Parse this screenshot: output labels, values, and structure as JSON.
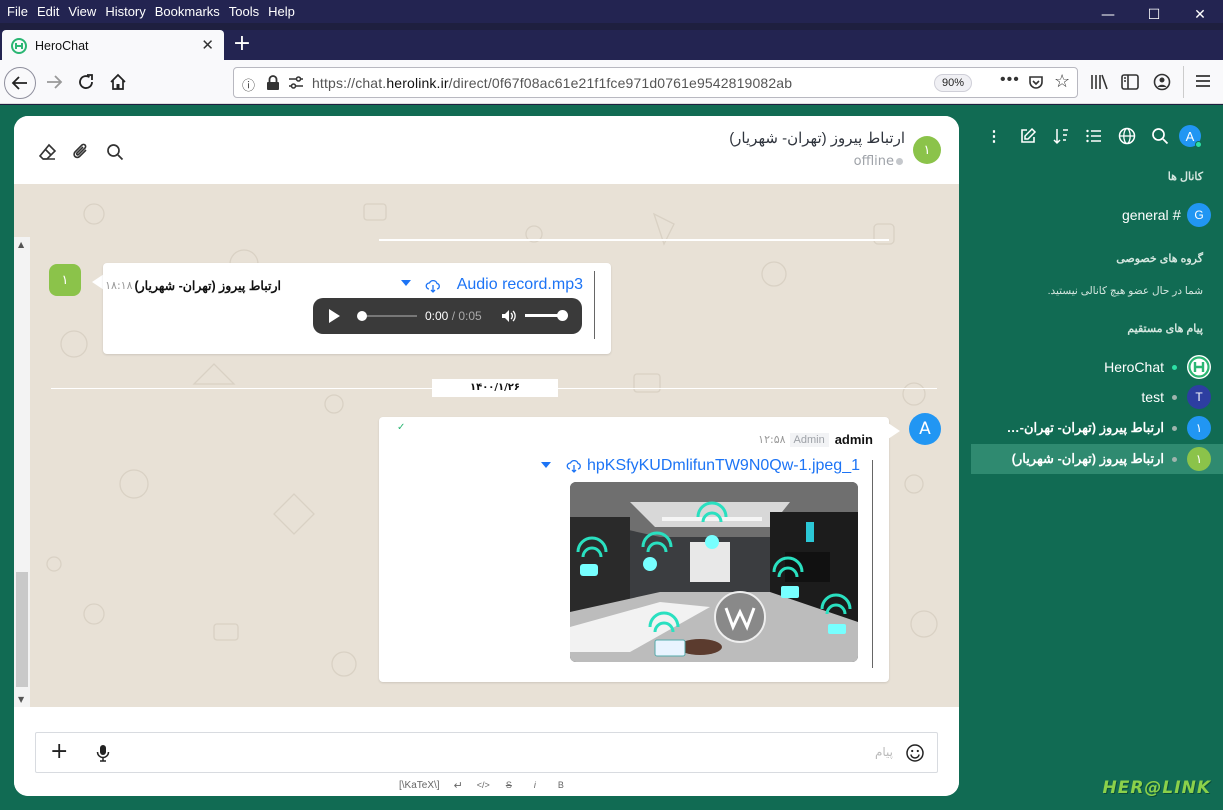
{
  "browser": {
    "menu": [
      "File",
      "Edit",
      "View",
      "History",
      "Bookmarks",
      "Tools",
      "Help"
    ],
    "tab_title": "HeroChat",
    "url_prefix": "https://chat.",
    "url_domain": "herolink.ir",
    "url_path": "/direct/0f67f08ac61e21f1fce971d0761e9542819082ab",
    "zoom": "90%",
    "win_min": "—",
    "win_max": "☐",
    "win_close": "✕"
  },
  "chat": {
    "contact_name": "ارتباط پیروز (تهران- شهریار)",
    "contact_status": "offline",
    "contact_avatar_letter": "۱",
    "messages": [
      {
        "author": "ارتباط پیروز (تهران- شهریار)",
        "time": "۱۸:۱۸",
        "avatar_letter": "۱",
        "file_name": "Audio record.mp3",
        "audio_current": "0:00",
        "audio_sep": " / ",
        "audio_total": "0:05",
        "progress": 0
      },
      {
        "date_divider": "۱۴۰۰/۱/۲۶"
      },
      {
        "author": "admin",
        "role": "Admin",
        "time": "۱۲:۵۸",
        "avatar_letter": "A",
        "file_name": "hpKSfyKUDmlifunTW9N0Qw-1.jpeg_1",
        "check": "✓"
      }
    ],
    "composer_placeholder": "پیام",
    "format_toolbar": [
      "B",
      "i",
      "S",
      "</>",
      "↵",
      "[\\KaTeX\\]"
    ]
  },
  "sidebar": {
    "user_avatar": "A",
    "channels_label": "کانال ها",
    "channels": [
      {
        "name": "general",
        "avatar": "G"
      }
    ],
    "groups_label": "گروه های خصوصی",
    "groups_empty": "شما در حال عضو هیچ کانالی نیستید.",
    "dm_label": "پیام های مستقیم",
    "dms": [
      {
        "name": "HeroChat",
        "avatar": "",
        "online": true
      },
      {
        "name": "test",
        "avatar": "T",
        "online": false
      },
      {
        "name": "ارتباط پیروز (تهران- تهران- شهر...",
        "avatar": "۱",
        "online": false
      },
      {
        "name": "ارتباط پیروز (تهران- شهریار)",
        "avatar": "۱",
        "online": false,
        "active": true
      }
    ],
    "brand": "HER@LINK"
  },
  "colors": {
    "sidebar_bg": "#116b53",
    "active_item": "#2f8a70",
    "link": "#1d74f5",
    "avatar_green": "#8bc34a",
    "avatar_blue": "#2196f3",
    "avatar_navy": "#2d3ea1"
  }
}
